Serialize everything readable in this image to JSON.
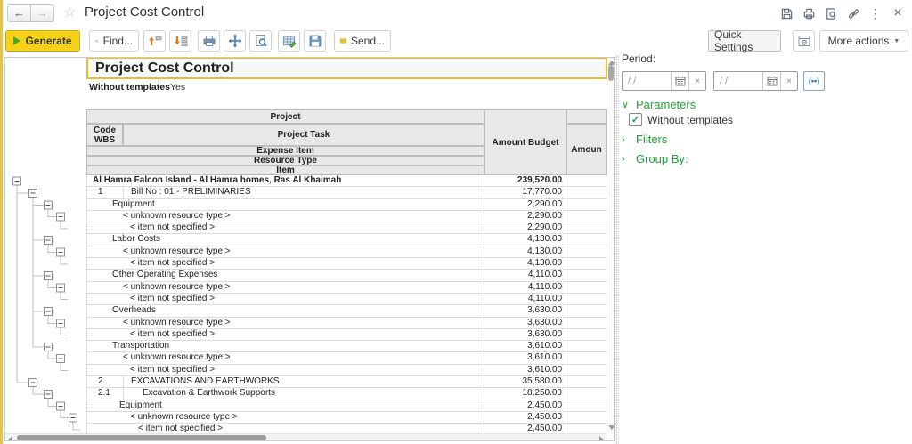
{
  "glyphs": {
    "back": "←",
    "forward": "→",
    "star": "☆",
    "kebab": "⋮",
    "close": "×",
    "caret_down": "▼",
    "chevron_open": "∨",
    "chevron_closed": "›",
    "check": "✓",
    "clear": "×",
    "period_icon": "(••)"
  },
  "colors": {
    "accent_yellow": "#f5d219",
    "title_frame_yellow": "#e6c02f",
    "left_stripe": "#e2c255",
    "green": "#21a038",
    "icon_blue": "#3c78b4",
    "icon_orange": "#e07820",
    "header_gray": "#e8e8e8"
  },
  "topbar": {
    "title": "Project Cost Control"
  },
  "toolbar": {
    "generate_label": "Generate",
    "find_label": "Find...",
    "send_label": "Send...",
    "quick_settings_label": "Quick Settings",
    "more_actions_label": "More actions"
  },
  "report": {
    "title": "Project Cost Control",
    "param_label": "Without templates",
    "param_value": "Yes",
    "header": {
      "project": "Project",
      "code_line1": "Code",
      "code_line2": "WBS",
      "project_task": "Project Task",
      "expense_item": "Expense Item",
      "resource_type": "Resource Type",
      "item": "Item",
      "amount_budget": "Amount Budget",
      "amount_next": "Amoun"
    },
    "rows": [
      {
        "text": "Al Hamra Falcon Island - Al Hamra homes, Ras Al Khaimah",
        "amount": "239,520.00",
        "bold": true,
        "indent": 6,
        "level": 0,
        "box": true
      },
      {
        "code": "1",
        "text": "Bill No : 01 - PRELIMINARIES",
        "amount": "17,770.00",
        "indent": 8,
        "level": 1,
        "box": true
      },
      {
        "text": "Equipment",
        "amount": "2,290.00",
        "indent": 28,
        "level": 2,
        "box": true
      },
      {
        "text": "< unknown resource type >",
        "amount": "2,290.00",
        "indent": 40,
        "level": 3,
        "box": true
      },
      {
        "text": "< item not specified >",
        "amount": "2,290.00",
        "indent": 48,
        "level": 4,
        "box": false
      },
      {
        "text": "Labor Costs",
        "amount": "4,130.00",
        "indent": 28,
        "level": 2,
        "box": true
      },
      {
        "text": "< unknown resource type >",
        "amount": "4,130.00",
        "indent": 40,
        "level": 3,
        "box": true
      },
      {
        "text": "< item not specified >",
        "amount": "4,130.00",
        "indent": 48,
        "level": 4,
        "box": false
      },
      {
        "text": "Other Operating Expenses",
        "amount": "4,110.00",
        "indent": 28,
        "level": 2,
        "box": true
      },
      {
        "text": "< unknown resource type >",
        "amount": "4,110.00",
        "indent": 40,
        "level": 3,
        "box": true
      },
      {
        "text": "< item not specified >",
        "amount": "4,110.00",
        "indent": 48,
        "level": 4,
        "box": false
      },
      {
        "text": "Overheads",
        "amount": "3,630.00",
        "indent": 28,
        "level": 2,
        "box": true
      },
      {
        "text": "< unknown resource type >",
        "amount": "3,630.00",
        "indent": 40,
        "level": 3,
        "box": true
      },
      {
        "text": "< item not specified >",
        "amount": "3,630.00",
        "indent": 48,
        "level": 4,
        "box": false
      },
      {
        "text": "Transportation",
        "amount": "3,610.00",
        "indent": 28,
        "level": 2,
        "box": true
      },
      {
        "text": "< unknown resource type >",
        "amount": "3,610.00",
        "indent": 40,
        "level": 3,
        "box": true
      },
      {
        "text": "< item not specified >",
        "amount": "3,610.00",
        "indent": 48,
        "level": 4,
        "box": false
      },
      {
        "code": "2",
        "text": "EXCAVATIONS AND EARTHWORKS",
        "amount": "35,580.00",
        "indent": 8,
        "level": 1,
        "box": true
      },
      {
        "code": "2.1",
        "text": "Excavation & Earthwork Supports",
        "amount": "18,250.00",
        "indent": 21,
        "level": 2,
        "box": true
      },
      {
        "text": "Equipment",
        "amount": "2,450.00",
        "indent": 36,
        "level": 3,
        "box": true
      },
      {
        "text": "< unknown resource type >",
        "amount": "2,450.00",
        "indent": 48,
        "level": 4,
        "box": true
      },
      {
        "text": "< item not specified >",
        "amount": "2,450.00",
        "indent": 57,
        "level": 5,
        "box": false
      }
    ]
  },
  "side_panel": {
    "period_label": "Period:",
    "date_placeholder": "/ /",
    "parameters_label": "Parameters",
    "without_templates_label": "Without templates",
    "without_templates_checked": true,
    "filters_label": "Filters",
    "group_by_label": "Group By:"
  }
}
